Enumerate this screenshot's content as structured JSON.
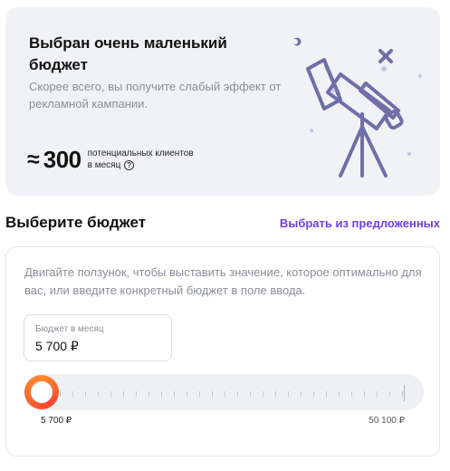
{
  "banner": {
    "title": "Выбран очень маленький бюджет",
    "subtitle": "Скорее всего, вы получите слабый эффект от рекламной кампании.",
    "approx_sign": "≈",
    "approx_value": "300",
    "approx_line1": "потенциальных клиентов",
    "approx_line2": "в месяц",
    "help_glyph": "?"
  },
  "section": {
    "title": "Выберите бюджет",
    "link": "Выбрать из предложенных"
  },
  "card": {
    "hint": "Двигайте ползунок, чтобы выставить значение, которое оптимально для вас, или введите конкретный бюджет в поле ввода.",
    "budget_label": "Бюджет в месяц",
    "budget_value": "5 700 ₽",
    "slider": {
      "min_label": "5 700 ₽",
      "max_label": "50 100 ₽",
      "current_fraction": 0.0
    }
  },
  "colors": {
    "accent": "#6d3fe6",
    "illustration": "#6e6fa8",
    "thumb_gradient_start": "#ff8c2e",
    "thumb_gradient_end": "#f5452e"
  }
}
